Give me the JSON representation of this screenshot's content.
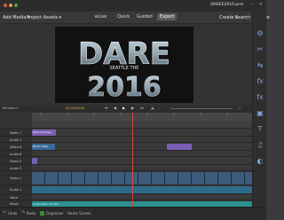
{
  "titlebar": {
    "project_name": "DAREE2016.prel"
  },
  "menubar": {
    "add_media": "Add Media ▾",
    "project_assets": "Project Assets ▾",
    "modes": [
      "eLive",
      "Quick",
      "Guided",
      "Expert"
    ],
    "active_mode": "Expert",
    "create": "Create ▾",
    "search_share": "Search & Share"
  },
  "preview": {
    "line1": "DARE",
    "line2": "2016",
    "tag": "SEATTLE THE"
  },
  "timeline_bar": {
    "label": "Renders ▾",
    "timecode": "00;00;00;00"
  },
  "tracks": [
    {
      "name": "Video 7",
      "type": "video"
    },
    {
      "name": "Audio 7",
      "type": "audio"
    },
    {
      "name": "Video 6",
      "type": "video"
    },
    {
      "name": "Audio 6",
      "type": "audio"
    },
    {
      "name": "Video 5",
      "type": "video"
    },
    {
      "name": "Audio 5",
      "type": "audio"
    },
    {
      "name": "Video 1",
      "type": "video"
    },
    {
      "name": "Audio 1",
      "type": "audio"
    },
    {
      "name": "Voice",
      "type": "audio"
    },
    {
      "name": "Music",
      "type": "audio"
    }
  ],
  "clips": {
    "title_clip": "Optical Flares",
    "video_clip": "Black Video",
    "music_clip": "Audio Music 01.wav"
  },
  "bottom": {
    "undo": "Undo",
    "redo": "Redo",
    "organizer": "Organizer",
    "home": "Home Screen"
  },
  "colors": {
    "accent": "#7ea4dd",
    "purple": "#7a5fb5",
    "teal": "#2b8f8f",
    "green": "#3c8a3c"
  }
}
